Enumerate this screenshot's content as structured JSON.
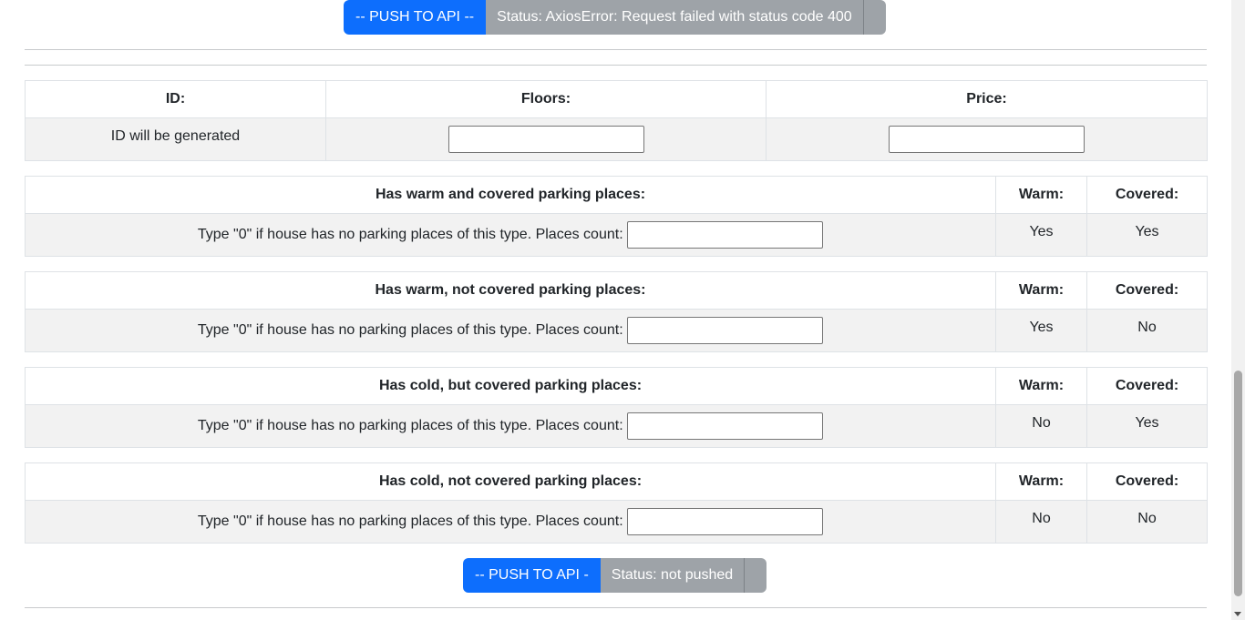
{
  "top_action": {
    "push_label": "-- PUSH TO API --",
    "status": "Status: AxiosError: Request failed with status code 400"
  },
  "house_table": {
    "headers": {
      "id": "ID:",
      "floors": "Floors:",
      "price": "Price:"
    },
    "id_value": "ID will be generated",
    "floors_value": "",
    "price_value": ""
  },
  "parking": [
    {
      "title": "Has warm and covered parking places:",
      "warm_header": "Warm:",
      "covered_header": "Covered:",
      "prompt": "Type \"0\" if house has no parking places of this type. Places count:",
      "count_value": "",
      "warm": "Yes",
      "covered": "Yes"
    },
    {
      "title": "Has warm, not covered parking places:",
      "warm_header": "Warm:",
      "covered_header": "Covered:",
      "prompt": "Type \"0\" if house has no parking places of this type. Places count:",
      "count_value": "",
      "warm": "Yes",
      "covered": "No"
    },
    {
      "title": "Has cold, but covered parking places:",
      "warm_header": "Warm:",
      "covered_header": "Covered:",
      "prompt": "Type \"0\" if house has no parking places of this type. Places count:",
      "count_value": "",
      "warm": "No",
      "covered": "Yes"
    },
    {
      "title": "Has cold, not covered parking places:",
      "warm_header": "Warm:",
      "covered_header": "Covered:",
      "prompt": "Type \"0\" if house has no parking places of this type. Places count:",
      "count_value": "",
      "warm": "No",
      "covered": "No"
    }
  ],
  "bottom_action": {
    "push_label": "-- PUSH TO API -",
    "status": "Status: not pushed"
  },
  "colors": {
    "primary": "#0d6efd",
    "secondary": "#9ea3a8",
    "row_bg": "#f2f2f2"
  }
}
